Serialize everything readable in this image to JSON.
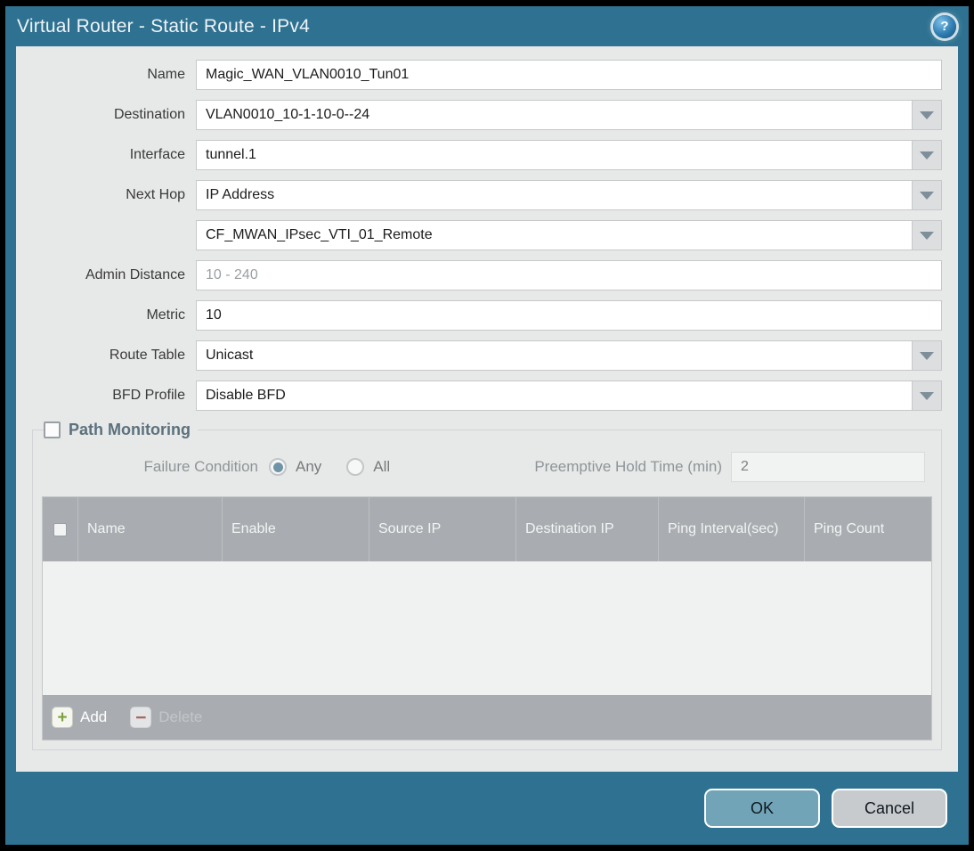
{
  "window": {
    "title": "Virtual Router - Static Route - IPv4",
    "help_glyph": "?"
  },
  "form": {
    "fields": {
      "name": {
        "label": "Name",
        "value": "Magic_WAN_VLAN0010_Tun01"
      },
      "destination": {
        "label": "Destination",
        "value": "VLAN0010_10-1-10-0--24"
      },
      "interface": {
        "label": "Interface",
        "value": "tunnel.1"
      },
      "next_hop": {
        "label": "Next Hop",
        "value": "IP Address"
      },
      "next_hop_value": {
        "label": "",
        "value": "CF_MWAN_IPsec_VTI_01_Remote"
      },
      "admin_distance": {
        "label": "Admin Distance",
        "value": "",
        "placeholder": "10 - 240"
      },
      "metric": {
        "label": "Metric",
        "value": "10"
      },
      "route_table": {
        "label": "Route Table",
        "value": "Unicast"
      },
      "bfd_profile": {
        "label": "BFD Profile",
        "value": "Disable BFD"
      }
    }
  },
  "path_monitoring": {
    "title": "Path Monitoring",
    "enabled": false,
    "failure_condition": {
      "label": "Failure Condition",
      "options": [
        {
          "label": "Any",
          "selected": true
        },
        {
          "label": "All",
          "selected": false
        }
      ]
    },
    "preemptive_hold_time": {
      "label": "Preemptive Hold Time (min)",
      "value": "2"
    },
    "table": {
      "headers": [
        "Name",
        "Enable",
        "Source IP",
        "Destination IP",
        "Ping Interval(sec)",
        "Ping Count"
      ],
      "rows": []
    },
    "actions": {
      "add": "Add",
      "delete": "Delete",
      "add_glyph": "+",
      "delete_glyph": "−"
    }
  },
  "footer": {
    "ok": "OK",
    "cancel": "Cancel"
  },
  "colors": {
    "frame_teal": "#2e7190",
    "content_bg": "#e7e8e8",
    "table_header_bg": "#a9adb1",
    "ok_button": "#72a4b8",
    "cancel_button": "#c8cbcd",
    "add_icon_green": "#7fa13c",
    "delete_icon_red": "#a56a62",
    "radio_selected": "#6f94a6"
  }
}
